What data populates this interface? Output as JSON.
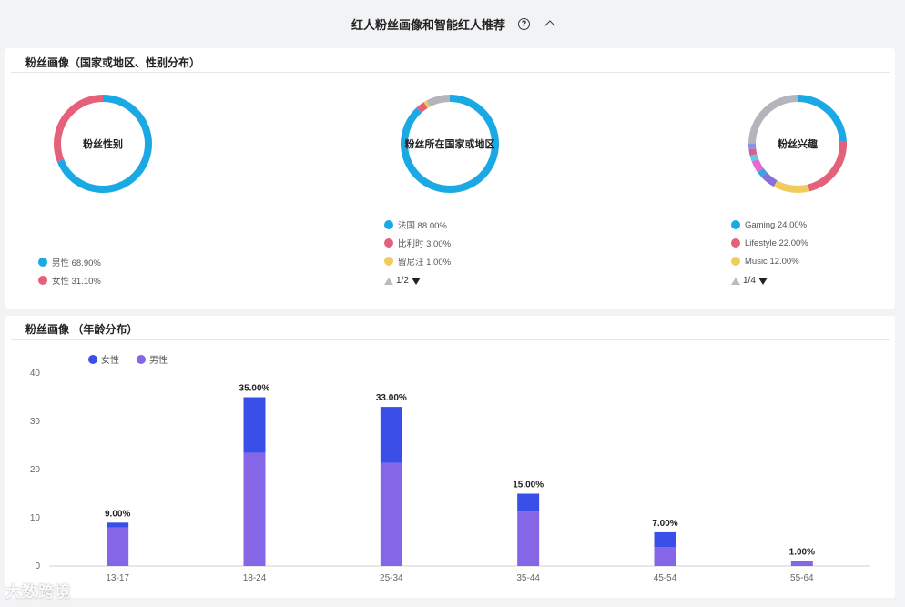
{
  "header": {
    "title": "红人粉丝画像和智能红人推荐",
    "help_icon": "?"
  },
  "gender_country_card": {
    "title": "粉丝画像（国家或地区、性别分布）",
    "gender": {
      "center_label": "粉丝性别",
      "slices": [
        {
          "name": "男性",
          "percent": 68.9,
          "label": "男性 68.90%",
          "color": "#1aa9e4"
        },
        {
          "name": "女性",
          "percent": 31.1,
          "label": "女性 31.10%",
          "color": "#e5607a"
        }
      ]
    },
    "country": {
      "center_label": "粉丝所在国家或地区",
      "slices": [
        {
          "name": "法国",
          "percent": 88.0,
          "label": "法国 88.00%",
          "color": "#1aa9e4"
        },
        {
          "name": "比利时",
          "percent": 3.0,
          "label": "比利时 3.00%",
          "color": "#e5607a"
        },
        {
          "name": "留尼汪",
          "percent": 1.0,
          "label": "留尼汪 1.00%",
          "color": "#f2cc5a"
        },
        {
          "name": "",
          "percent": 8.0,
          "color": "#b4b4bc"
        }
      ],
      "pager": "1/2"
    },
    "interest": {
      "center_label": "粉丝兴趣",
      "slices": [
        {
          "name": "Gaming",
          "percent": 24.0,
          "label": "Gaming 24.00%",
          "color": "#1aa9e4"
        },
        {
          "name": "Lifestyle",
          "percent": 22.0,
          "label": "Lifestyle 22.00%",
          "color": "#e5607a"
        },
        {
          "name": "Music",
          "percent": 12.0,
          "label": "Music 12.00%",
          "color": "#f2cc5a"
        },
        {
          "name": "",
          "percent": 5.0,
          "color": "#8a6fd8"
        },
        {
          "name": "",
          "percent": 2.0,
          "color": "#3aa3e0"
        },
        {
          "name": "",
          "percent": 4.0,
          "color": "#e46ad0"
        },
        {
          "name": "",
          "percent": 2.0,
          "color": "#5fcbe6"
        },
        {
          "name": "",
          "percent": 2.0,
          "color": "#e05a8c"
        },
        {
          "name": "",
          "percent": 2.0,
          "color": "#8f8fe8"
        },
        {
          "name": "",
          "percent": 25.0,
          "color": "#b4b4bc"
        }
      ],
      "pager": "1/4"
    }
  },
  "age_card": {
    "title": "粉丝画像 （年龄分布）"
  },
  "chart_data": {
    "type": "bar",
    "stacked": true,
    "categories": [
      "13-17",
      "18-24",
      "25-34",
      "35-44",
      "45-54",
      "55-64"
    ],
    "series": [
      {
        "name": "女性",
        "color": "#3a4fe8",
        "values": [
          1.0,
          11.5,
          11.6,
          3.7,
          3.1,
          0.0
        ]
      },
      {
        "name": "男性",
        "color": "#8566e6",
        "values": [
          8.0,
          23.5,
          21.4,
          11.3,
          3.9,
          1.0
        ]
      }
    ],
    "totals": [
      9.0,
      35.0,
      33.0,
      15.0,
      7.0,
      1.0
    ],
    "data_labels": [
      "9.00%",
      "35.00%",
      "33.00%",
      "15.00%",
      "7.00%",
      "1.00%"
    ],
    "ylim": [
      0,
      40
    ],
    "yticks": [
      0,
      10,
      20,
      30,
      40
    ],
    "legend_position": "top-left",
    "grid": false
  },
  "watermark": "大数跨境"
}
